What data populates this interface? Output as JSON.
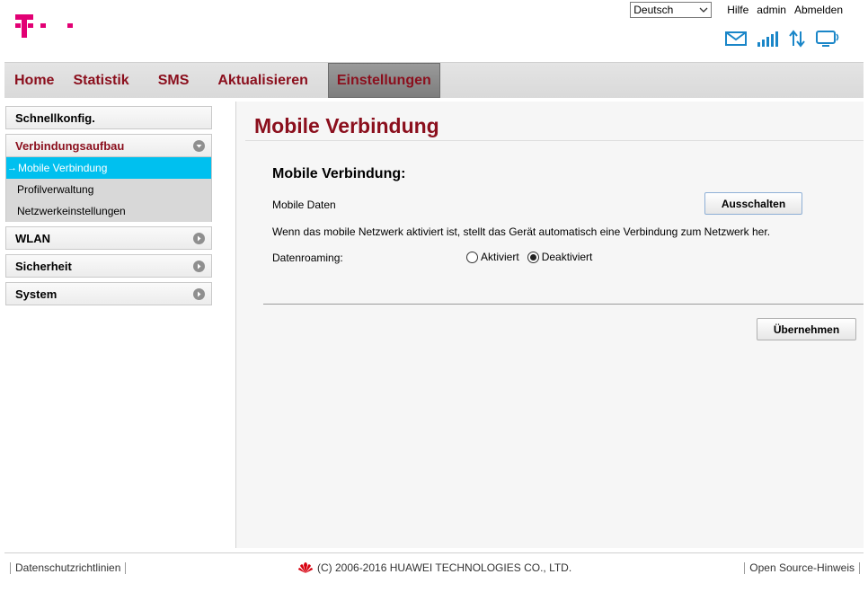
{
  "header": {
    "language_selected": "Deutsch",
    "links": [
      "Hilfe",
      "admin",
      "Abmelden"
    ],
    "status_icons": [
      "mail-icon",
      "signal-icon",
      "data-transfer-icon",
      "connection-monitor-icon"
    ],
    "brand_color": "#e20074"
  },
  "nav": {
    "items": [
      "Home",
      "Statistik",
      "SMS",
      "Aktualisieren",
      "Einstellungen"
    ],
    "active": "Einstellungen",
    "accent": "#8b0f1d"
  },
  "sidebar": {
    "groups": [
      {
        "label": "Schnellkonfig."
      },
      {
        "label": "Verbindungsaufbau",
        "expanded": true,
        "items": [
          "Mobile Verbindung",
          "Profilverwaltung",
          "Netzwerkeinstellungen"
        ],
        "active_item": "Mobile Verbindung"
      },
      {
        "label": "WLAN"
      },
      {
        "label": "Sicherheit"
      },
      {
        "label": "System"
      }
    ],
    "active_color": "#00c0ef"
  },
  "main": {
    "page_title": "Mobile Verbindung",
    "section_title": "Mobile Verbindung:",
    "mobile_data_label": "Mobile Daten",
    "mobile_data_button": "Ausschalten",
    "description": "Wenn das mobile Netzwerk aktiviert ist, stellt das Gerät automatisch eine Verbindung zum Netzwerk her.",
    "roaming_label": "Datenroaming:",
    "roaming_options": [
      "Aktiviert",
      "Deaktiviert"
    ],
    "roaming_selected": "Deaktiviert",
    "apply_button": "Übernehmen"
  },
  "footer": {
    "privacy_link": "Datenschutzrichtlinien",
    "copyright": "(C) 2006-2016 HUAWEI TECHNOLOGIES CO., LTD.",
    "open_source_link": "Open Source-Hinweis"
  }
}
